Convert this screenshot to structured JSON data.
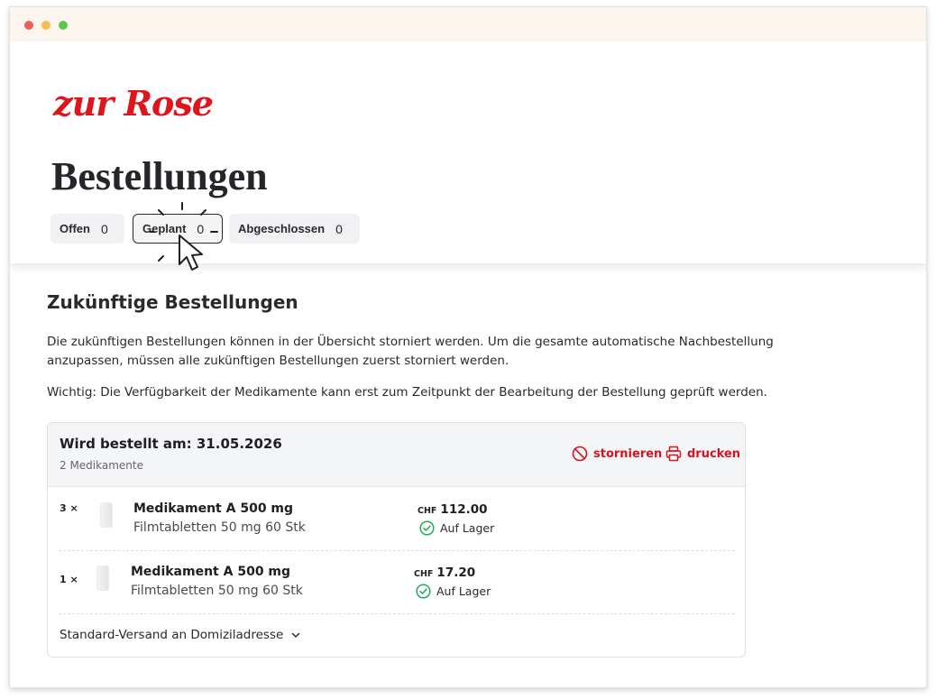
{
  "brand": {
    "logo_text": "zur Rose",
    "accent": "#e0141c"
  },
  "page": {
    "title": "Bestellungen"
  },
  "tabs": [
    {
      "label": "Offen",
      "count": "0"
    },
    {
      "label": "Geplant",
      "count": "0",
      "active": true
    },
    {
      "label": "Abgeschlossen",
      "count": "0"
    }
  ],
  "section": {
    "title": "Zukünftige Bestellungen",
    "paragraph1": "Die zukünftigen Bestellungen können in der Übersicht storniert werden. Um die gesamte automatische Nachbestellung anzupassen, müssen alle zukünftigen Bestellungen zuerst storniert werden.",
    "paragraph2": "Wichtig: Die Verfügbarkeit der Medikamente kann erst zum Zeitpunkt der Bearbeitung der Bestellung geprüft werden."
  },
  "order": {
    "date_label": "Wird bestellt am:  31.05.2026",
    "count_label": "2 Medikamente",
    "cancel_label": "stornieren",
    "print_label": "drucken",
    "items": [
      {
        "qty": "3 ×",
        "name": "Medikament A 500 mg",
        "desc": "Filmtabletten 50 mg 60 Stk",
        "currency": "CHF",
        "price": "112.00",
        "stock": "Auf Lager"
      },
      {
        "qty": "1 ×",
        "name": "Medikament A 500 mg",
        "desc": "Filmtabletten 50 mg 60 Stk",
        "currency": "CHF",
        "price": "17.20",
        "stock": "Auf Lager"
      }
    ],
    "shipping_label": "Standard-Versand an Domiziladresse"
  },
  "icons": {
    "cancel": "cancel-icon",
    "print": "printer-icon",
    "stock": "check-circle-icon",
    "expand": "chevron-down-icon",
    "pointer": "mouse-pointer-icon"
  },
  "colors": {
    "stock_ok": "#1fae57",
    "action": "#d8121e",
    "titlebar": "#fcf6ee"
  }
}
